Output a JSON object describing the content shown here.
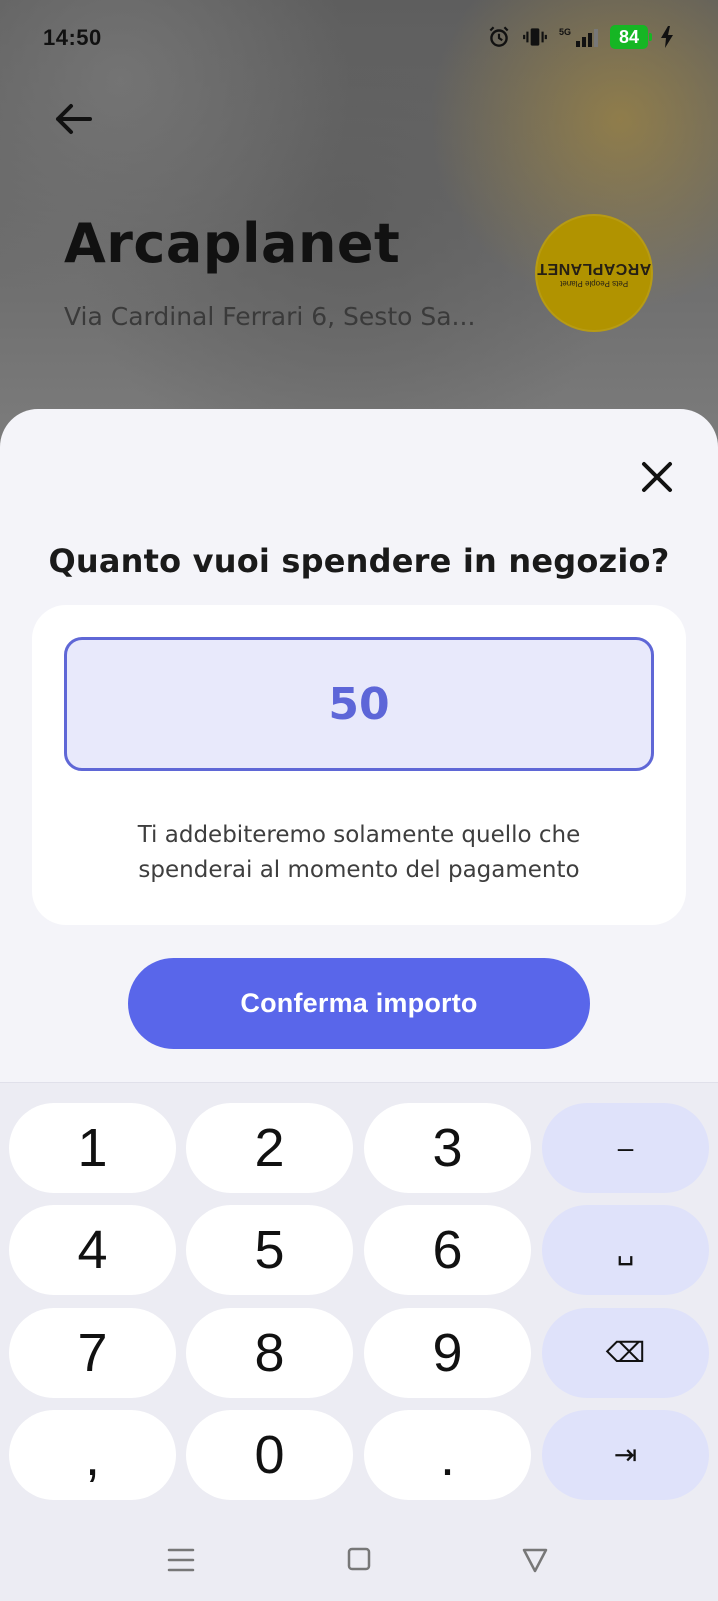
{
  "status_bar": {
    "time": "14:50",
    "network": "5G",
    "battery_level": "84",
    "icons": [
      "alarm-icon",
      "vibrate-icon",
      "signal-icon",
      "charging-icon"
    ]
  },
  "store": {
    "name": "Arcaplanet",
    "address": "Via Cardinal Ferrari 6, Sesto Sa...",
    "logo": {
      "title": "ARCAPLANET",
      "tagline": "Pets People Planet"
    }
  },
  "sheet": {
    "question": "Quanto vuoi spendere in negozio?",
    "amount": "50",
    "notice": "Ti addebiteremo solamente quello che spenderai al momento del pagamento",
    "confirm_label": "Conferma importo"
  },
  "keyboard": {
    "keys": [
      "1",
      "2",
      "3",
      "–",
      "4",
      "5",
      "6",
      "␣",
      "7",
      "8",
      "9",
      "⌫",
      ",",
      "0",
      ".",
      "⇥"
    ]
  },
  "colors": {
    "accent": "#5966ea",
    "input_border": "#5f67d6",
    "input_background": "#e8e9fb",
    "sheet_background": "#f4f4f9",
    "battery_green": "#16b624",
    "function_key": "#dfe2fa"
  }
}
